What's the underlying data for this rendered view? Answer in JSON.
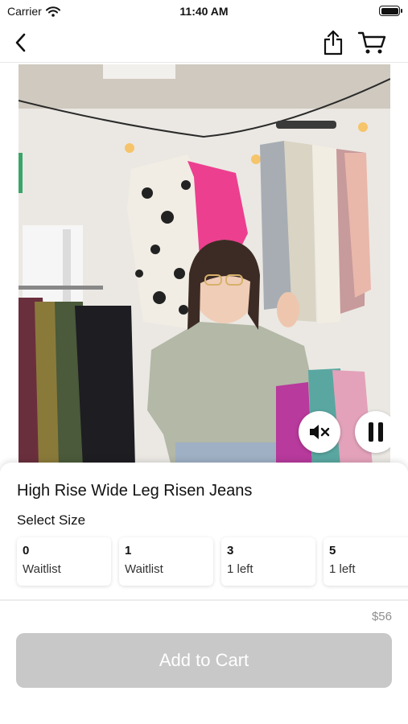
{
  "status_bar": {
    "carrier": "Carrier",
    "time": "11:40 AM",
    "wifi_icon": "wifi-icon",
    "battery_icon": "battery-icon"
  },
  "nav": {
    "back_icon": "chevron-left-icon",
    "share_icon": "share-icon",
    "cart_icon": "cart-icon"
  },
  "video": {
    "mute_icon": "speaker-muted-icon",
    "pause_icon": "pause-icon"
  },
  "product": {
    "title": "High Rise Wide Leg Risen Jeans",
    "select_size_label": "Select Size",
    "sizes": [
      {
        "size": "0",
        "status": "Waitlist"
      },
      {
        "size": "1",
        "status": "Waitlist"
      },
      {
        "size": "3",
        "status": "1 left"
      },
      {
        "size": "5",
        "status": "1 left"
      }
    ],
    "price": "$56",
    "add_to_cart_label": "Add to Cart"
  },
  "colors": {
    "button_disabled": "#c8c8c8",
    "price_gray": "#8e8e8e"
  }
}
